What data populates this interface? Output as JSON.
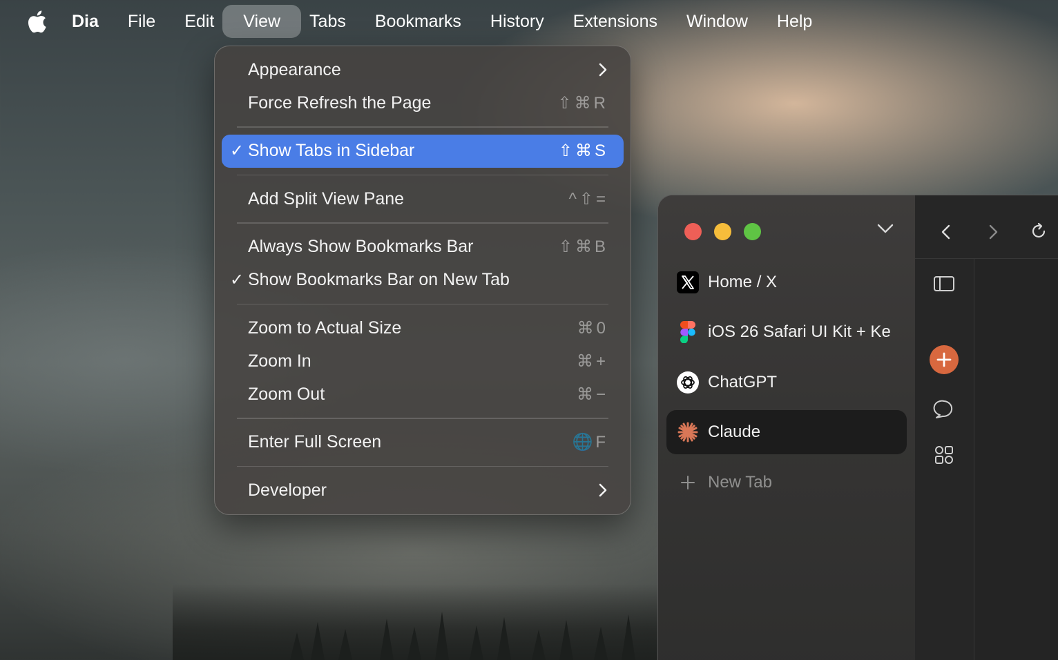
{
  "menubar": {
    "app_name": "Dia",
    "items": [
      "File",
      "Edit",
      "View",
      "Tabs",
      "Bookmarks",
      "History",
      "Extensions",
      "Window",
      "Help"
    ],
    "active": "View"
  },
  "view_menu": {
    "items": [
      {
        "label": "Appearance",
        "submenu": true
      },
      {
        "label": "Force Refresh the Page",
        "shortcut": "⇧⌘R"
      },
      {
        "label": "Show Tabs in Sidebar",
        "shortcut": "⇧⌘S",
        "checked": true,
        "highlighted": true
      },
      {
        "label": "Add Split View Pane",
        "shortcut": "^⇧="
      },
      {
        "label": "Always Show Bookmarks Bar",
        "shortcut": "⇧⌘B"
      },
      {
        "label": "Show Bookmarks Bar on New Tab",
        "checked": true
      },
      {
        "label": "Zoom to Actual Size",
        "shortcut": "⌘0"
      },
      {
        "label": "Zoom In",
        "shortcut": "⌘+"
      },
      {
        "label": "Zoom Out",
        "shortcut": "⌘−"
      },
      {
        "label": "Enter Full Screen",
        "shortcut": "🌐F"
      },
      {
        "label": "Developer",
        "submenu": true
      }
    ],
    "check_glyph": "✓"
  },
  "browser": {
    "tabs": [
      {
        "title": "Home / X",
        "icon": "x-logo-icon"
      },
      {
        "title": "iOS 26 Safari UI Kit + Ke",
        "icon": "figma-icon"
      },
      {
        "title": "ChatGPT",
        "icon": "chatgpt-icon"
      },
      {
        "title": "Claude",
        "icon": "claude-icon",
        "active": true
      }
    ],
    "new_tab_label": "New Tab"
  },
  "colors": {
    "highlight": "#4a7de6",
    "traffic_close": "#ee5f57",
    "traffic_minimize": "#f6bd3b",
    "traffic_zoom": "#5fc444",
    "accent_plus": "#d8683f"
  }
}
